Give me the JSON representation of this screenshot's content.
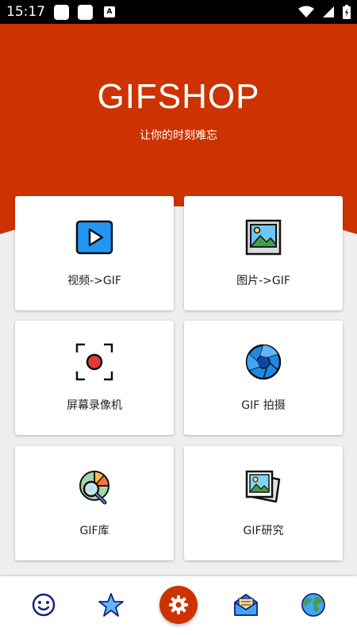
{
  "status_bar": {
    "time": "15:17",
    "notif_icon_label": "A"
  },
  "header": {
    "title": "GIFSHOP",
    "subtitle": "让你的时刻难忘"
  },
  "features": [
    {
      "label": "视频->GIF",
      "icon": "video-play-icon"
    },
    {
      "label": "图片->GIF",
      "icon": "picture-icon"
    },
    {
      "label": "屏幕录像机",
      "icon": "screen-record-icon"
    },
    {
      "label": "GIF 拍摄",
      "icon": "camera-aperture-icon"
    },
    {
      "label": "GIF库",
      "icon": "gif-library-icon"
    },
    {
      "label": "GIF研究",
      "icon": "gif-research-icon"
    }
  ],
  "bottom_nav": [
    {
      "icon": "smiley-icon"
    },
    {
      "icon": "star-icon"
    },
    {
      "icon": "settings-gear-icon"
    },
    {
      "icon": "mail-icon"
    },
    {
      "icon": "globe-icon"
    }
  ],
  "colors": {
    "brand": "#cc3300",
    "background": "#eeeeee",
    "card": "#ffffff"
  }
}
